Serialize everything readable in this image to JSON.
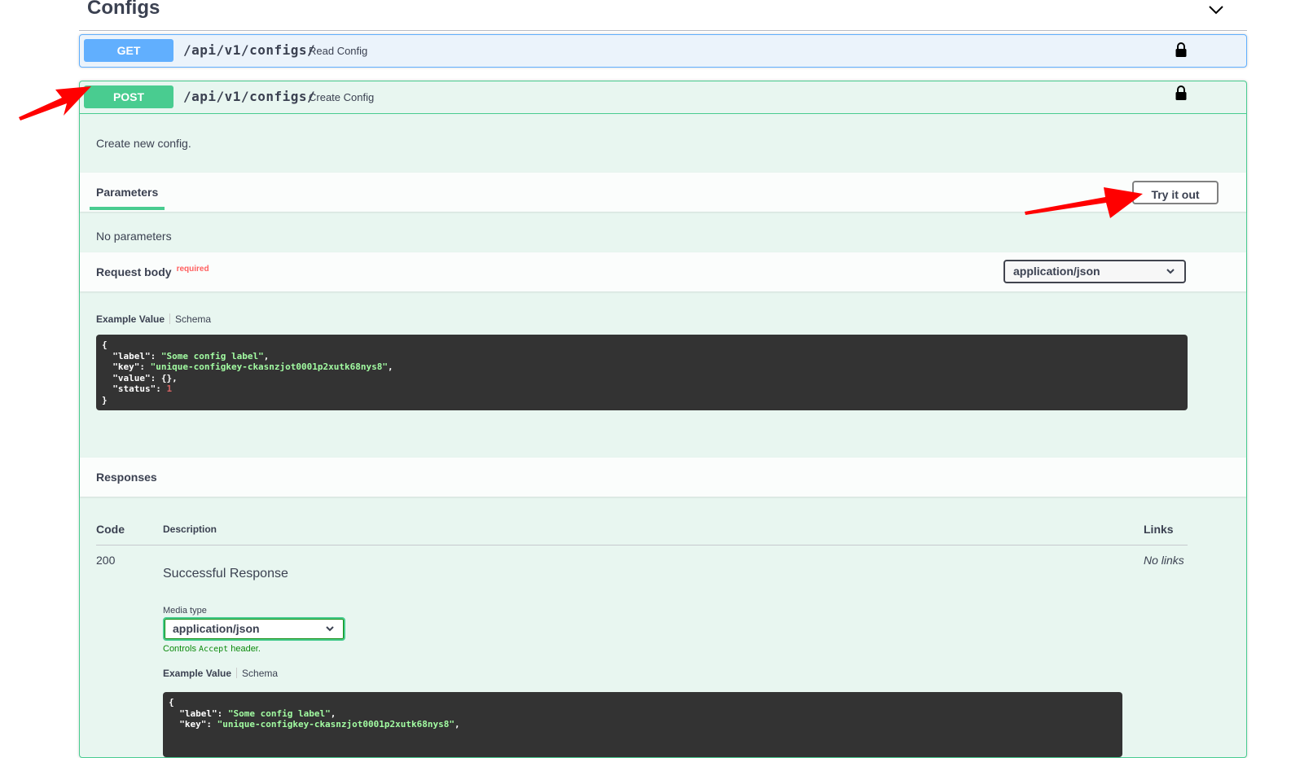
{
  "section": {
    "title": "Configs"
  },
  "get_op": {
    "method": "GET",
    "path": "/api/v1/configs/",
    "summary": "Read Config"
  },
  "post_op": {
    "method": "POST",
    "path": "/api/v1/configs/",
    "summary": "Create Config",
    "description": "Create new config.",
    "parameters_tab": "Parameters",
    "try_it_out": "Try it out",
    "no_parameters": "No parameters",
    "request_body": {
      "title": "Request body",
      "required": "required",
      "content_type": "application/json",
      "example_tab": "Example Value",
      "schema_tab": "Schema",
      "example": {
        "l1": "{",
        "label_key": "  \"label\"",
        "label_val": "\"Some config label\"",
        "key_key": "  \"key\"",
        "key_val": "\"unique-configkey-ckasnzjot0001p2xutk68nys8\"",
        "value_line": "  \"value\": {},",
        "status_key": "  \"status\"",
        "status_val": "1",
        "l_end": "}"
      }
    },
    "responses": {
      "title": "Responses",
      "col_code": "Code",
      "col_description": "Description",
      "col_links": "Links",
      "rows": [
        {
          "code": "200",
          "description": "Successful Response",
          "links": "No links",
          "media_type_label": "Media type",
          "media_type": "application/json",
          "controls_prefix": "Controls",
          "controls_mono": "Accept",
          "controls_suffix": "header.",
          "example_tab": "Example Value",
          "schema_tab": "Schema",
          "example": {
            "l1": "{",
            "label_key": "  \"label\"",
            "label_val": "\"Some config label\"",
            "key_key": "  \"key\"",
            "key_val": "\"unique-configkey-ckasnzjot0001p2xutk68nys8\""
          }
        }
      ]
    }
  },
  "colors": {
    "get": "#61affe",
    "post": "#49cc90",
    "annotation_arrow": "#ff0000"
  }
}
